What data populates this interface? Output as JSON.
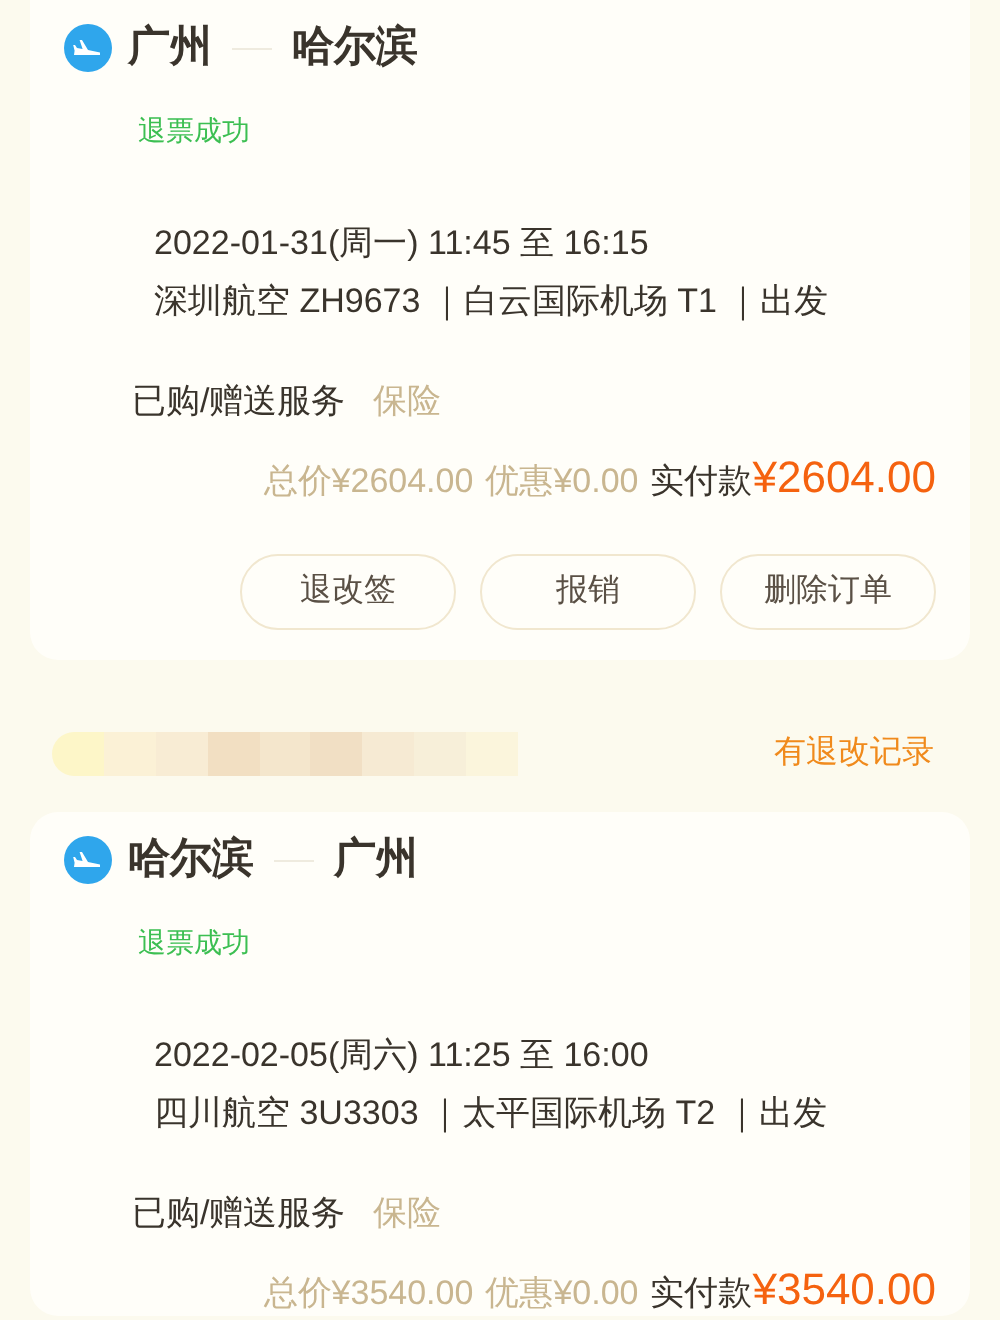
{
  "orders": [
    {
      "from": "广州",
      "to": "哈尔滨",
      "status": "退票成功",
      "datetime": "2022-01-31(周一) 11:45 至 16:15",
      "flight": "深圳航空 ZH9673 ｜白云国际机场 T1 ｜出发",
      "services_label": "已购/赠送服务",
      "services_value": "保险",
      "total": "总价¥2604.00",
      "discount": "优惠¥0.00",
      "paid_label": "实付款",
      "paid_amount": "¥2604.00",
      "actions": [
        "退改签",
        "报销",
        "删除订单"
      ]
    },
    {
      "record_link": "有退改记录",
      "from": "哈尔滨",
      "to": "广州",
      "status": "退票成功",
      "datetime": "2022-02-05(周六) 11:25 至 16:00",
      "flight": "四川航空 3U3303 ｜太平国际机场 T2 ｜出发",
      "services_label": "已购/赠送服务",
      "services_value": "保险",
      "total": "总价¥3540.00",
      "discount": "优惠¥0.00",
      "paid_label": "实付款",
      "paid_amount": "¥3540.00"
    }
  ]
}
